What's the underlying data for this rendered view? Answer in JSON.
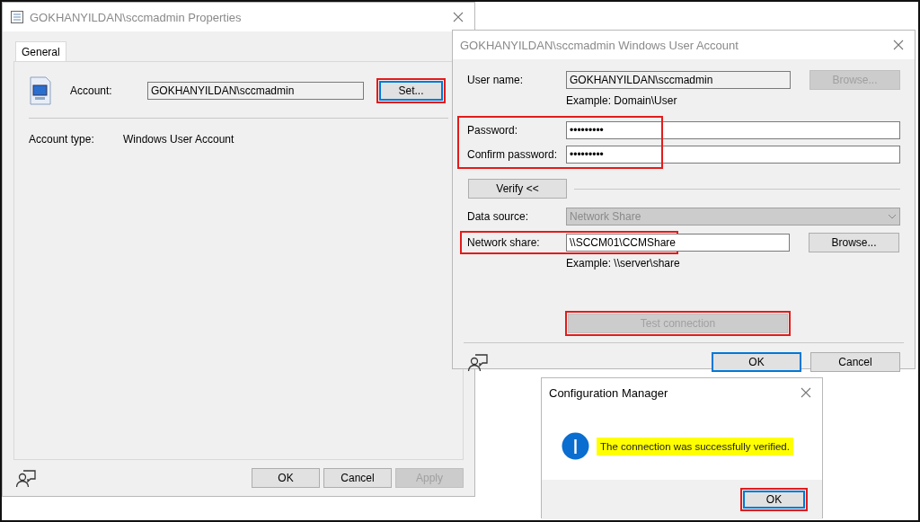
{
  "properties_window": {
    "title": "GOKHANYILDAN\\sccmadmin Properties",
    "tabs": [
      {
        "label": "General",
        "selected": true
      }
    ],
    "account_label": "Account:",
    "account_value": "GOKHANYILDAN\\sccmadmin",
    "set_button": {
      "label": "Set...",
      "highlighted": true
    },
    "account_type_label": "Account type:",
    "account_type_value": "Windows User Account",
    "buttons": [
      {
        "label": "OK",
        "disabled": false
      },
      {
        "label": "Cancel",
        "disabled": false
      },
      {
        "label": "Apply",
        "disabled": true
      }
    ]
  },
  "account_window": {
    "title": "GOKHANYILDAN\\sccmadmin Windows User Account",
    "user_name": {
      "label": "User name:",
      "value": "GOKHANYILDAN\\sccmadmin",
      "browse": {
        "label": "Browse...",
        "disabled": true
      },
      "example": "Example: Domain\\User"
    },
    "credentials": {
      "highlighted": true,
      "password": {
        "label": "Password:",
        "value": "•••••••••"
      },
      "confirm": {
        "label": "Confirm password:",
        "value": "•••••••••"
      }
    },
    "verify_button": {
      "label": "Verify <<"
    },
    "data_source": {
      "label": "Data source:",
      "value": "Network Share",
      "disabled": true
    },
    "network_share": {
      "label": "Network share:",
      "value": "\\\\SCCM01\\CCMShare",
      "highlighted": true,
      "browse": {
        "label": "Browse...",
        "disabled": false
      },
      "example": "Example: \\\\server\\share"
    },
    "test_button": {
      "label": "Test connection",
      "disabled": true,
      "highlighted": true
    },
    "buttons": [
      {
        "label": "OK",
        "default": true
      },
      {
        "label": "Cancel",
        "default": false
      }
    ]
  },
  "message_box": {
    "title": "Configuration Manager",
    "message": "The connection was successfully verified.",
    "message_highlighted": true,
    "ok_button": {
      "label": "OK",
      "highlighted": true
    }
  }
}
